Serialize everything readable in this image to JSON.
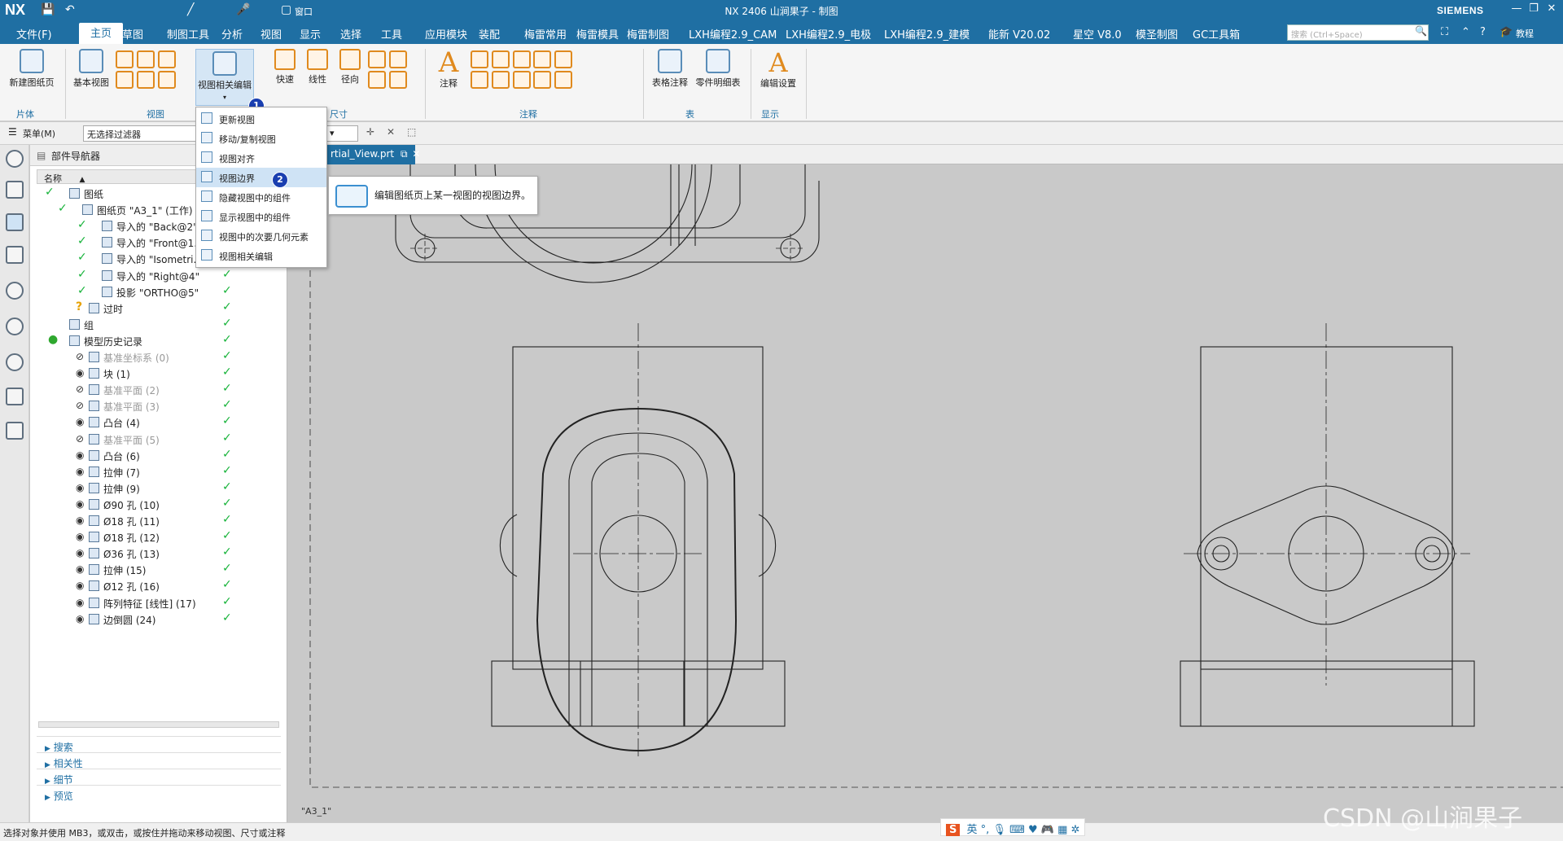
{
  "app": {
    "logo": "NX",
    "title": "NX 2406 山涧果子 - 制图",
    "brand": "SIEMENS",
    "window_menu": "窗口"
  },
  "menubar": {
    "file": "文件(F)",
    "items": [
      "主页",
      "草图",
      "制图工具",
      "分析",
      "视图",
      "显示",
      "选择",
      "工具",
      "应用模块",
      "装配",
      "梅雷常用",
      "梅雷模具",
      "梅雷制图",
      "LXH编程2.9_CAM",
      "LXH编程2.9_电极",
      "LXH编程2.9_建模",
      "能新 V20.02",
      "星空 V8.0",
      "模圣制图",
      "GC工具箱"
    ],
    "active_index": 0,
    "search_placeholder": "搜索 (Ctrl+Space)",
    "tutorial": "教程"
  },
  "ribbon": {
    "buttons": {
      "new_sheet": "新建图纸页",
      "base_view": "基本视图",
      "view_edit": "视图相关编辑",
      "rapid": "快速",
      "linear": "线性",
      "radial": "径向",
      "note": "注释",
      "table_note": "表格注释",
      "parts_list": "零件明细表",
      "edit_settings": "编辑设置"
    },
    "groups": {
      "sheet": "片体",
      "view": "视图",
      "dimension": "尺寸",
      "annotation": "注释",
      "table": "表",
      "display": "显示"
    }
  },
  "toolbar2": {
    "menu": "菜单(M)",
    "filter": "无选择过滤器"
  },
  "navigator": {
    "title": "部件导航器",
    "column_name": "名称",
    "rows": [
      {
        "label": "图纸",
        "dim": false
      },
      {
        "label": "图纸页 \"A3_1\" (工作)",
        "dim": false
      },
      {
        "label": "导入的 \"Back@2\"",
        "dim": false
      },
      {
        "label": "导入的 \"Front@1...",
        "dim": false
      },
      {
        "label": "导入的 \"Isometri...",
        "dim": false
      },
      {
        "label": "导入的 \"Right@4\"",
        "dim": false
      },
      {
        "label": "投影 \"ORTHO@5\"",
        "dim": false
      },
      {
        "label": "过时",
        "dim": false
      },
      {
        "label": "组",
        "dim": false
      },
      {
        "label": "模型历史记录",
        "dim": false
      },
      {
        "label": "基准坐标系 (0)",
        "dim": true
      },
      {
        "label": "块 (1)",
        "dim": false
      },
      {
        "label": "基准平面 (2)",
        "dim": true
      },
      {
        "label": "基准平面 (3)",
        "dim": true
      },
      {
        "label": "凸台 (4)",
        "dim": false
      },
      {
        "label": "基准平面 (5)",
        "dim": true
      },
      {
        "label": "凸台 (6)",
        "dim": false
      },
      {
        "label": "拉伸 (7)",
        "dim": false
      },
      {
        "label": "拉伸 (9)",
        "dim": false
      },
      {
        "label": "Ø90 孔 (10)",
        "dim": false
      },
      {
        "label": "Ø18 孔 (11)",
        "dim": false
      },
      {
        "label": "Ø18 孔 (12)",
        "dim": false
      },
      {
        "label": "Ø36 孔 (13)",
        "dim": false
      },
      {
        "label": "拉伸 (15)",
        "dim": false
      },
      {
        "label": "Ø12 孔 (16)",
        "dim": false
      },
      {
        "label": "阵列特征 [线性] (17)",
        "dim": false
      },
      {
        "label": "边倒圆 (24)",
        "dim": false
      }
    ],
    "sections": [
      "搜索",
      "相关性",
      "细节",
      "预览"
    ]
  },
  "tab": {
    "label": "rtial_View.prt"
  },
  "dropdown": {
    "items": [
      "更新视图",
      "移动/复制视图",
      "视图对齐",
      "视图边界",
      "隐藏视图中的组件",
      "显示视图中的组件",
      "视图中的次要几何元素",
      "视图相关编辑"
    ],
    "highlight_index": 3
  },
  "tooltip": {
    "text": "编辑图纸页上某一视图的视图边界。"
  },
  "badges": {
    "one": "1",
    "two": "2"
  },
  "canvas": {
    "sheet_label": "\"A3_1\""
  },
  "status": {
    "text": "选择对象并使用 MB3，或双击，或按住并拖动来移动视图、尺寸或注释"
  },
  "ime": {
    "lang": "英"
  },
  "watermark": "CSDN @山涧果子"
}
